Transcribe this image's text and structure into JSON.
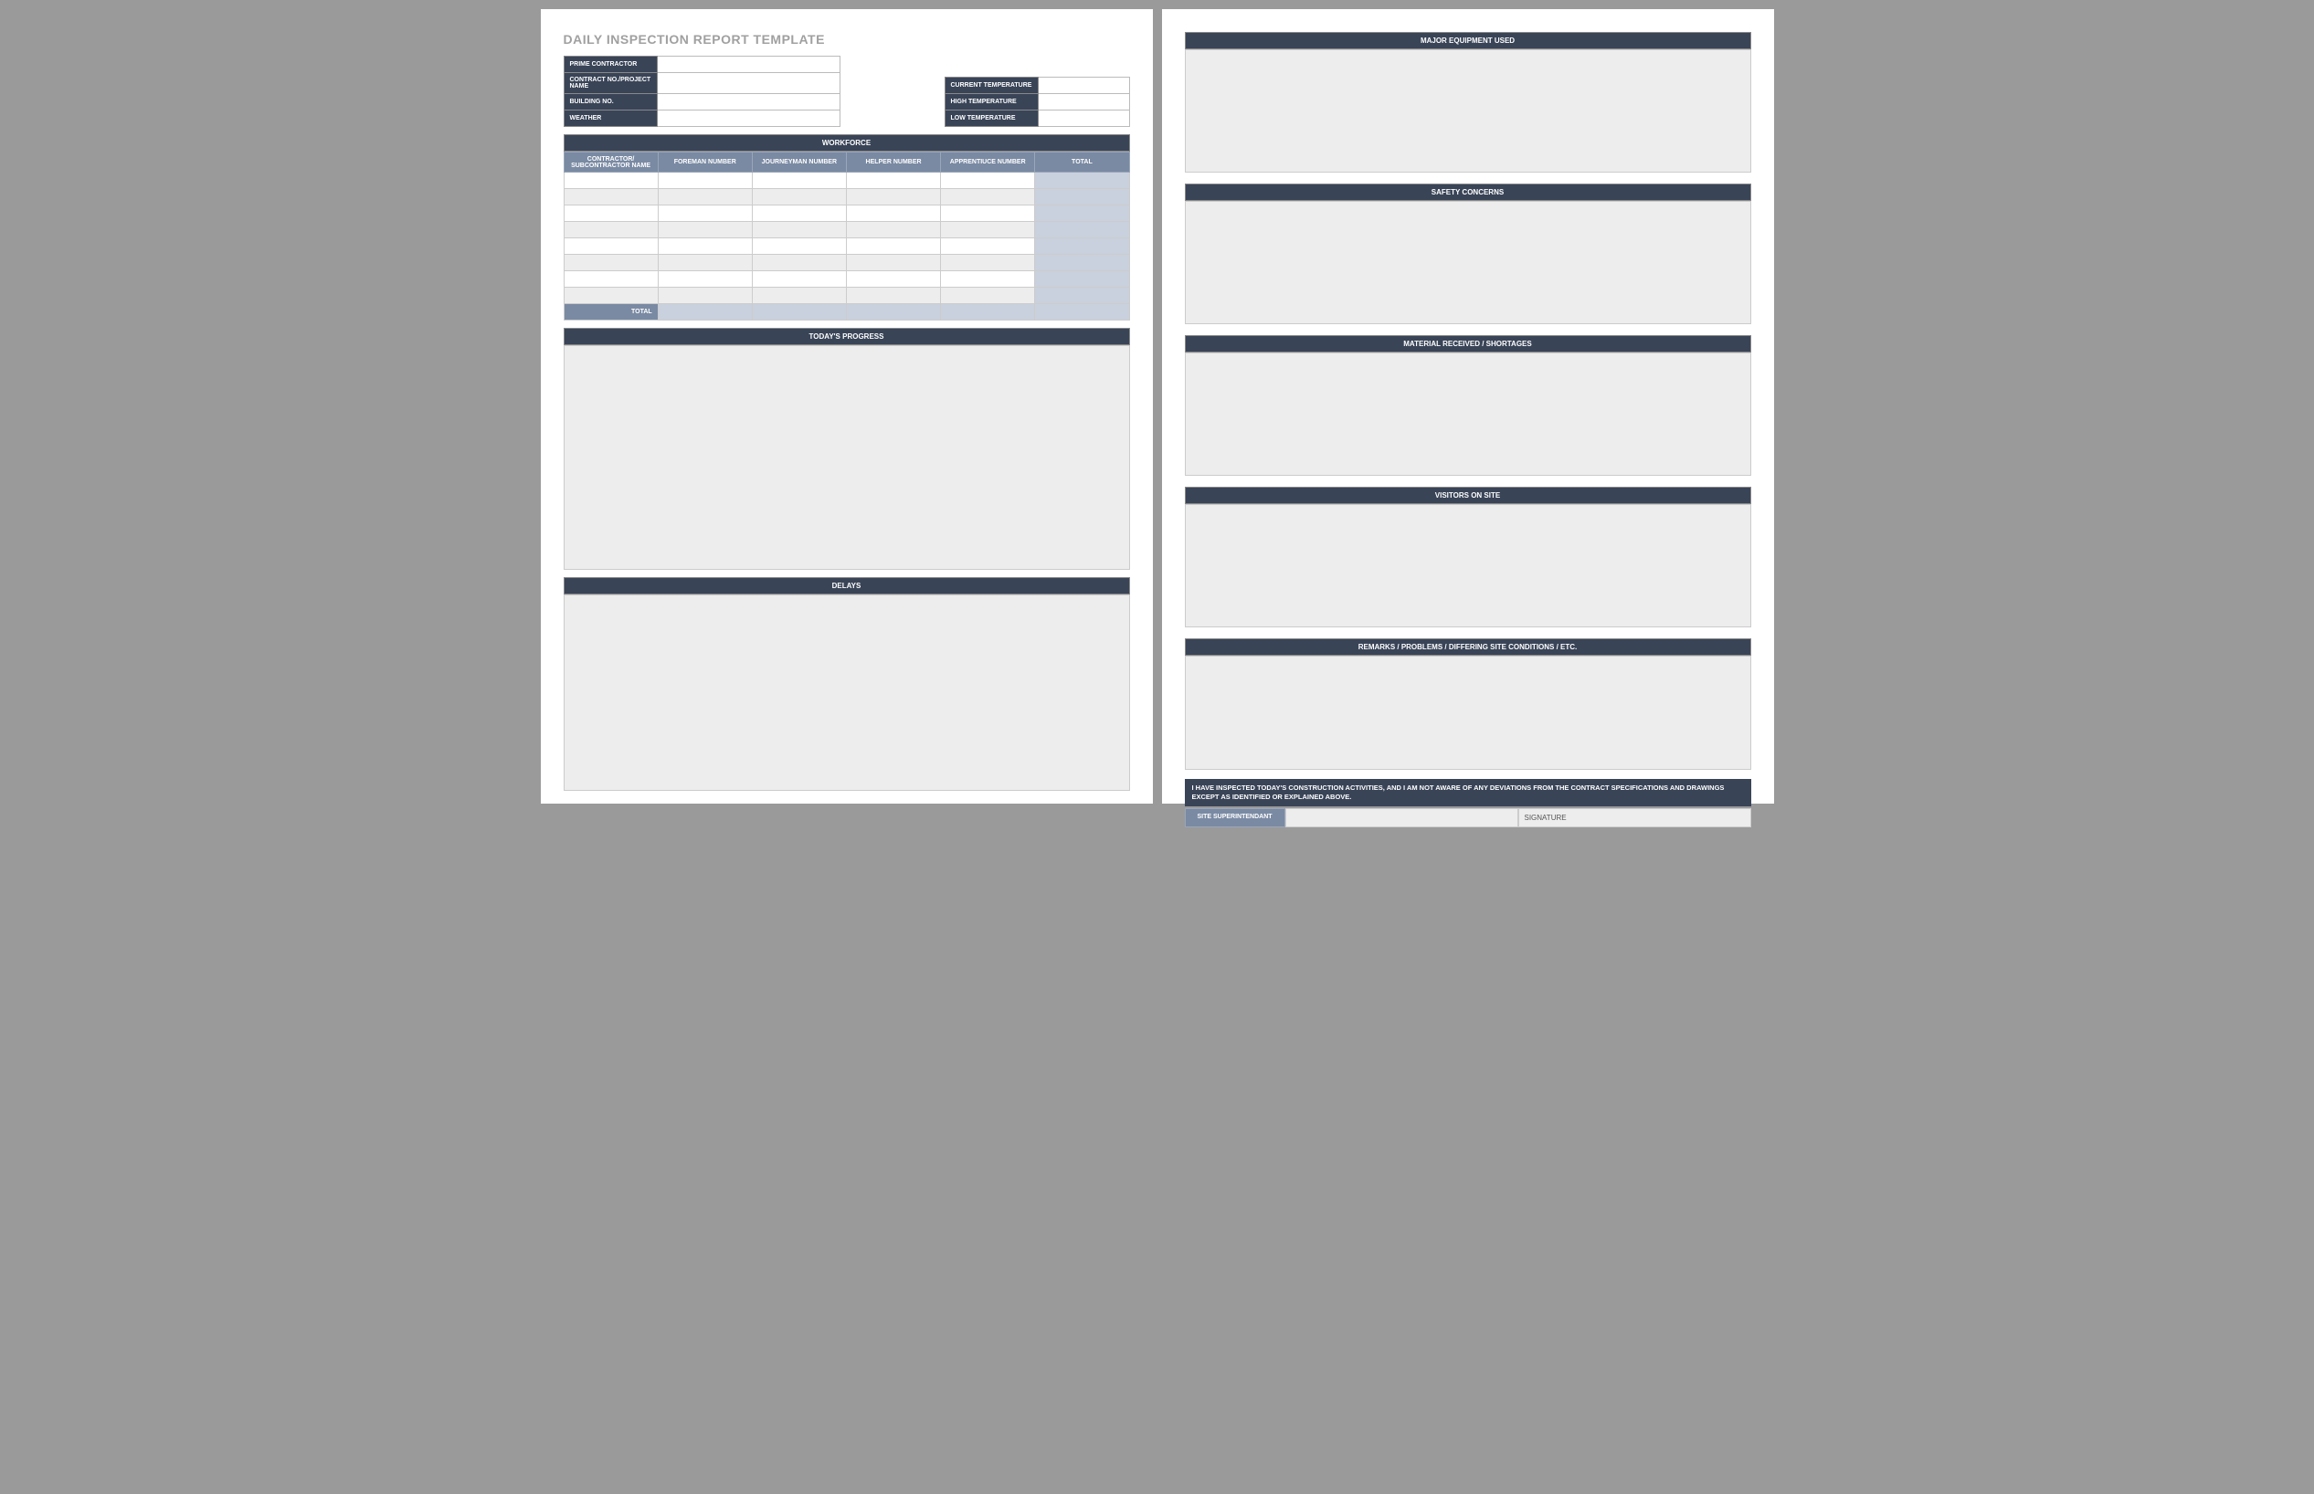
{
  "title": "DAILY INSPECTION REPORT TEMPLATE",
  "info_left": {
    "prime_contractor": "PRIME CONTRACTOR",
    "contract_no": "CONTRACT NO./PROJECT NAME",
    "building_no": "BUILDING NO.",
    "weather": "WEATHER"
  },
  "info_right": {
    "current_temp": "CURRENT TEMPERATURE",
    "high_temp": "HIGH TEMPERATURE",
    "low_temp": "LOW TEMPERATURE"
  },
  "workforce": {
    "header": "WORKFORCE",
    "cols": {
      "contractor": "CONTRACTOR/ SUBCONTRACTOR NAME",
      "foreman": "FOREMAN NUMBER",
      "journeyman": "JOURNEYMAN NUMBER",
      "helper": "HELPER NUMBER",
      "apprentice": "APPRENTIUCE NUMBER",
      "total": "TOTAL"
    },
    "total_label": "TOTAL"
  },
  "sections": {
    "progress": "TODAY'S PROGRESS",
    "delays": "DELAYS",
    "equipment": "MAJOR EQUIPMENT USED",
    "safety": "SAFETY CONCERNS",
    "material": "MATERIAL RECEIVED / SHORTAGES",
    "visitors": "VISITORS ON SITE",
    "remarks": "REMARKS / PROBLEMS / DIFFERING SITE CONDITIONS / ETC."
  },
  "certification": "I HAVE INSPECTED TODAY'S CONSTRUCTION ACTIVITIES, AND I AM NOT AWARE OF ANY DEVIATIONS FROM THE CONTRACT SPECIFICATIONS AND DRAWINGS EXCEPT AS IDENTIFIED OR EXPLAINED ABOVE.",
  "signature": {
    "label": "SITE SUPERINTENDANT",
    "sig_label": "SIGNATURE"
  }
}
